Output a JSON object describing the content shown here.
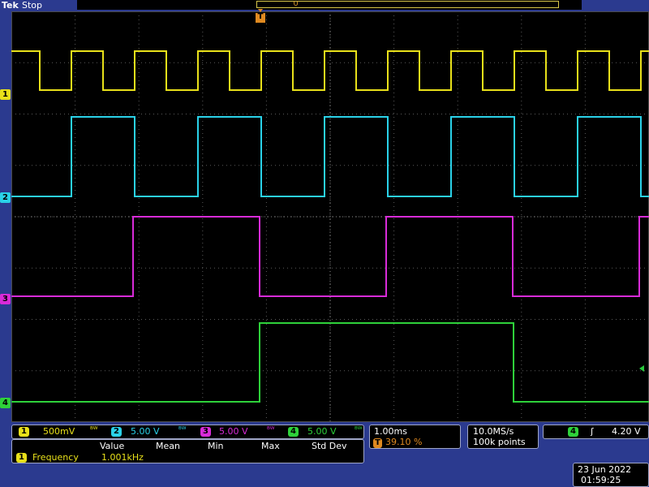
{
  "header": {
    "brand": "Tek",
    "status": "Stop"
  },
  "channels": [
    {
      "id": "1",
      "color": "#e8e01a",
      "scale": "500mV",
      "marker_label": "1"
    },
    {
      "id": "2",
      "color": "#2ad1e8",
      "scale": "5.00 V",
      "marker_label": "2"
    },
    {
      "id": "3",
      "color": "#d82bd8",
      "scale": "5.00 V",
      "marker_label": "3"
    },
    {
      "id": "4",
      "color": "#2ed13a",
      "scale": "5.00 V",
      "marker_label": "4"
    }
  ],
  "bandwidth_icon": "bandwidth-limit-icon",
  "trigger_marker_label": "T",
  "record_marker": "∪",
  "measurements": {
    "headers": [
      "Value",
      "Mean",
      "Min",
      "Max",
      "Std Dev"
    ],
    "rows": [
      {
        "channel": "1",
        "label": "Frequency",
        "value": "1.001kHz"
      }
    ]
  },
  "timebase": {
    "scale": "1.00ms",
    "trigger_position": "39.10 %",
    "trigger_icon": "T"
  },
  "acquisition": {
    "sample_rate": "10.0MS/s",
    "record_length": "100k points"
  },
  "trigger": {
    "source": "4",
    "slope_icon": "rising-edge-icon",
    "slope_glyph": "ʃ",
    "level": "4.20 V"
  },
  "datetime": {
    "date": "23 Jun  2022",
    "time": "01:59:25"
  }
}
